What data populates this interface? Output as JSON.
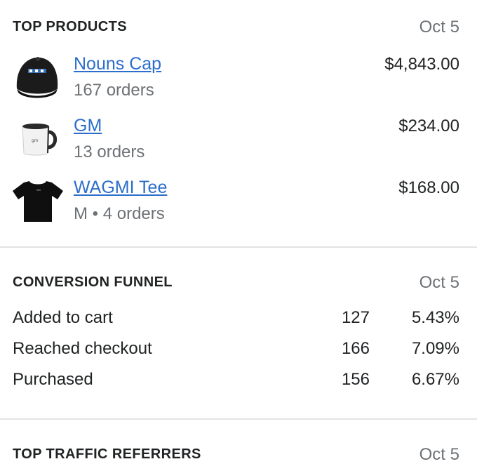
{
  "top_products": {
    "title": "TOP PRODUCTS",
    "date": "Oct 5",
    "items": [
      {
        "name": "Nouns Cap",
        "subtitle": "167 orders",
        "price": "$4,843.00",
        "icon": "cap-image"
      },
      {
        "name": "GM",
        "subtitle": "13 orders",
        "price": "$234.00",
        "icon": "mug-image"
      },
      {
        "name": "WAGMI Tee",
        "subtitle": "M • 4 orders",
        "price": "$168.00",
        "icon": "tshirt-image"
      }
    ]
  },
  "conversion_funnel": {
    "title": "CONVERSION FUNNEL",
    "date": "Oct 5",
    "rows": [
      {
        "label": "Added to cart",
        "count": "127",
        "percent": "5.43%"
      },
      {
        "label": "Reached checkout",
        "count": "166",
        "percent": "7.09%"
      },
      {
        "label": "Purchased",
        "count": "156",
        "percent": "6.67%"
      }
    ]
  },
  "top_traffic_referrers": {
    "title": "TOP TRAFFIC REFERRERS",
    "date": "Oct 5"
  },
  "colors": {
    "link": "#2c6ecb",
    "muted": "#6d7175",
    "divider": "#e1e3e5",
    "text": "#202223"
  }
}
